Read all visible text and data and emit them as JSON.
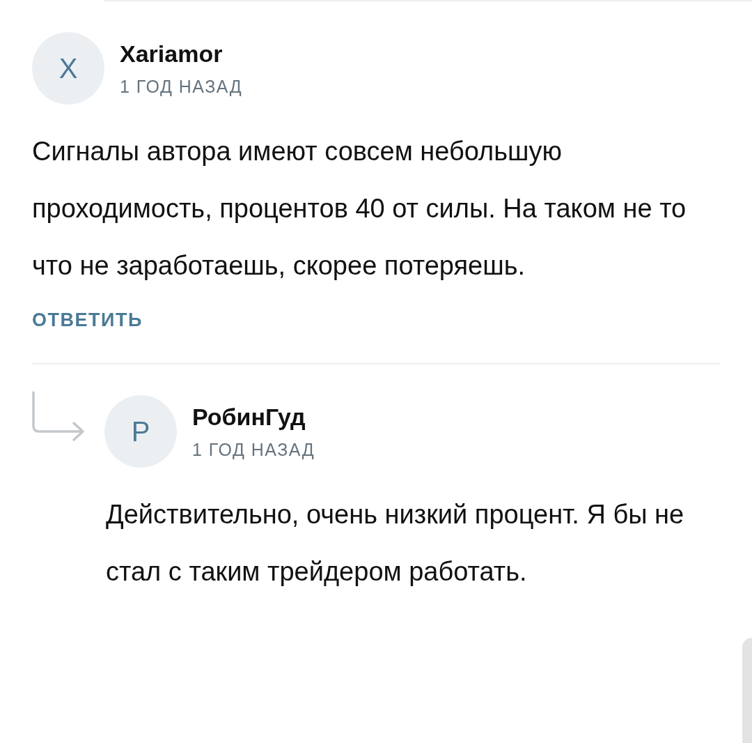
{
  "comments": [
    {
      "avatar_letter": "X",
      "author": "Xariamor",
      "time": "1 ГОД НАЗАД",
      "text": "Сигналы автора имеют совсем небольшую проходимость, процентов 40 от силы. На таком не то что не заработаешь, скорее потеряешь.",
      "reply_button": "ОТВЕТИТЬ"
    }
  ],
  "replies": [
    {
      "avatar_letter": "Р",
      "author": "РобинГуд",
      "time": "1 ГОД НАЗАД",
      "text": "Действительно, очень низкий процент. Я бы не стал с таким трейдером работать."
    }
  ]
}
